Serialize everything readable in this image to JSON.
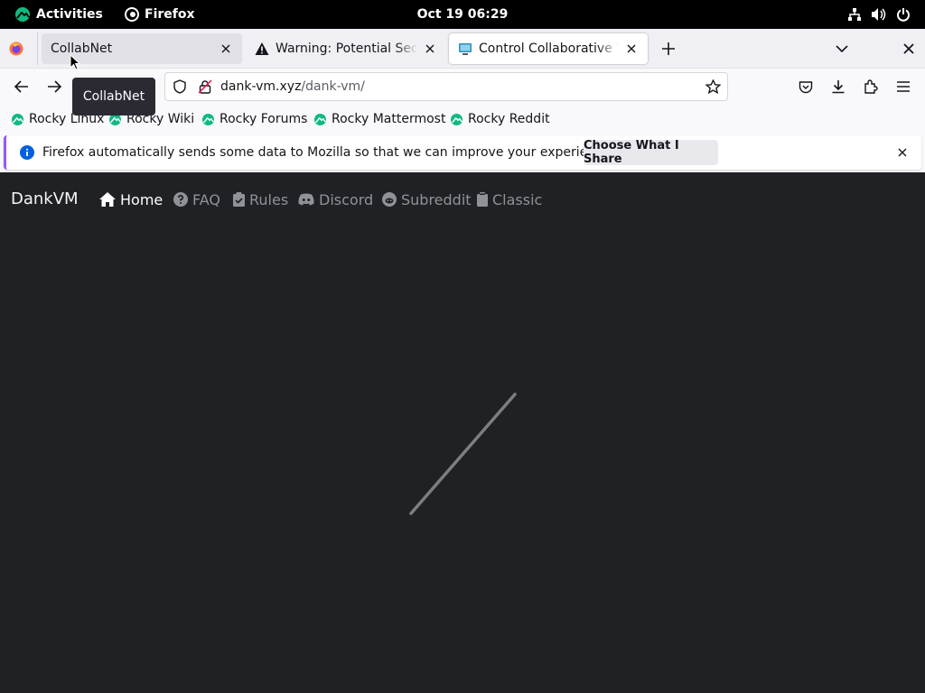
{
  "topbar": {
    "activities_label": "Activities",
    "app_label": "Firefox",
    "clock": "Oct 19  06:29"
  },
  "tabs": [
    {
      "title": "CollabNet",
      "close_icon": "close-icon"
    },
    {
      "title": "Warning: Potential Security Risk Ahead",
      "close_icon": "close-icon"
    },
    {
      "title": "Control Collaborative Virtual Machines",
      "close_icon": "close-icon",
      "active": true
    }
  ],
  "tooltip": "CollabNet",
  "url": {
    "domain": "dank-vm.xyz",
    "path": "/dank-vm/"
  },
  "bookmarks": [
    {
      "label": "Rocky Linux"
    },
    {
      "label": "Rocky Wiki"
    },
    {
      "label": "Rocky Forums"
    },
    {
      "label": "Rocky Mattermost"
    },
    {
      "label": "Rocky Reddit"
    }
  ],
  "notification": {
    "message": "Firefox automatically sends some data to Mozilla so that we can improve your experience.",
    "button_label": "Choose What I Share"
  },
  "site": {
    "brand": "DankVM",
    "nav": [
      {
        "label": "Home",
        "icon": "home-icon",
        "active": true
      },
      {
        "label": "FAQ",
        "icon": "question-circle-icon"
      },
      {
        "label": "Rules",
        "icon": "clipboard-check-icon"
      },
      {
        "label": "Discord",
        "icon": "discord-icon"
      },
      {
        "label": "Subreddit",
        "icon": "reddit-icon"
      },
      {
        "label": "Classic",
        "icon": "clipboard-icon"
      }
    ]
  },
  "colors": {
    "page_bg": "#1f2124",
    "accent": "#9059ff",
    "rocky_green": "#10b981"
  }
}
